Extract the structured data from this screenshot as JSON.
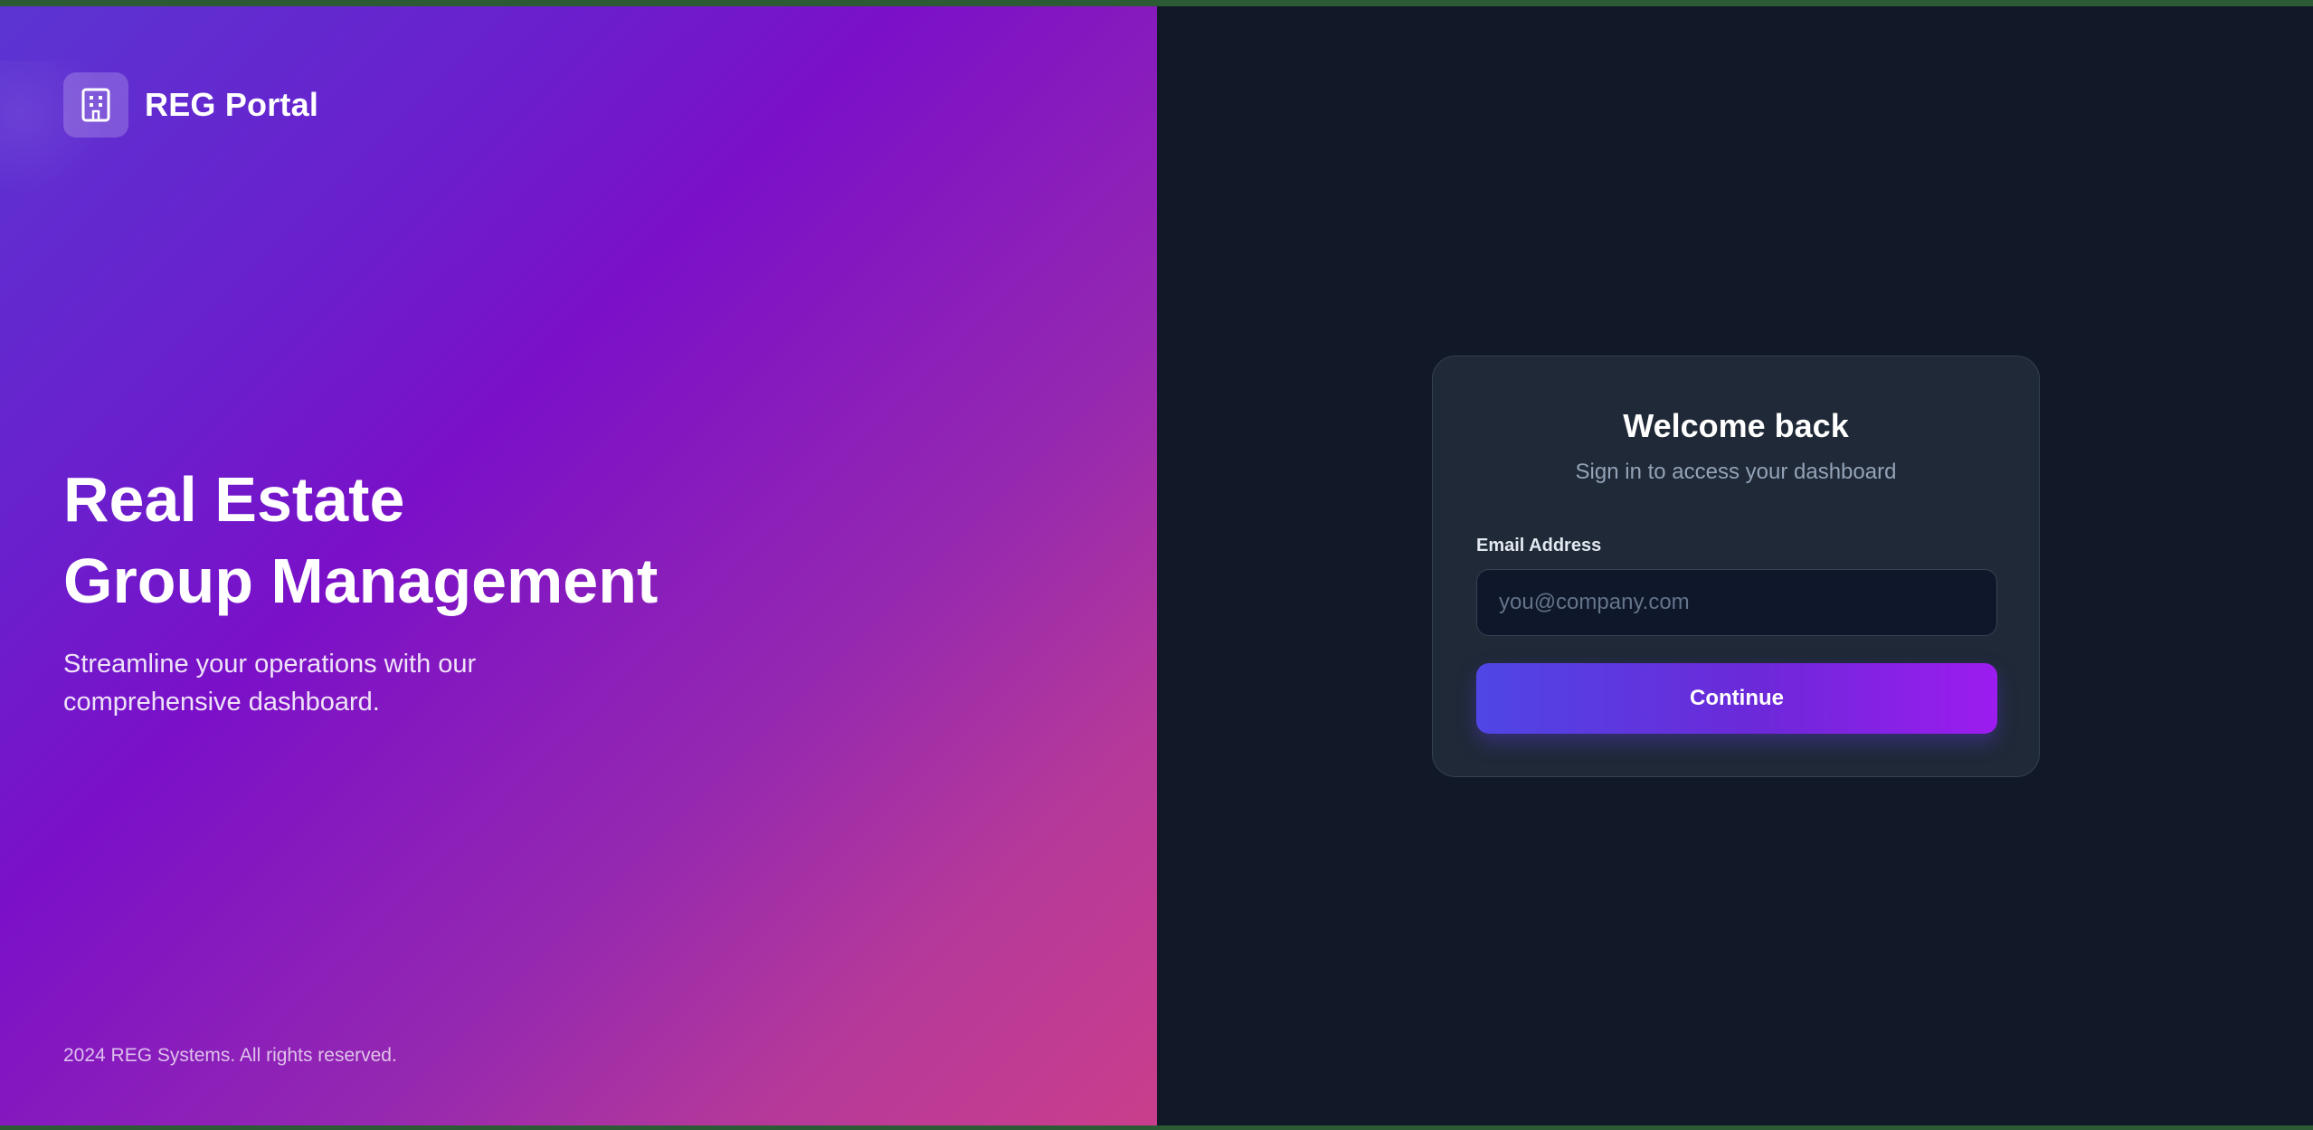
{
  "brand": {
    "title": "REG Portal",
    "icon": "building-icon"
  },
  "hero": {
    "title_line1": "Real Estate",
    "title_line2": "Group Management",
    "subtitle": "Streamline your operations with our comprehensive dashboard."
  },
  "footer": {
    "copyright": "2024 REG Systems. All rights reserved."
  },
  "login": {
    "title": "Welcome back",
    "subtitle": "Sign in to access your dashboard",
    "email_label": "Email Address",
    "email_placeholder": "you@company.com",
    "email_value": "",
    "continue_label": "Continue"
  },
  "colors": {
    "left_gradient_start": "#5b35d2",
    "left_gradient_mid": "#7b10c8",
    "left_gradient_end": "#c93e8c",
    "right_bg": "#111827",
    "card_bg": "#1f2937",
    "button_start": "#4f46e5",
    "button_end": "#9d1cf0"
  }
}
